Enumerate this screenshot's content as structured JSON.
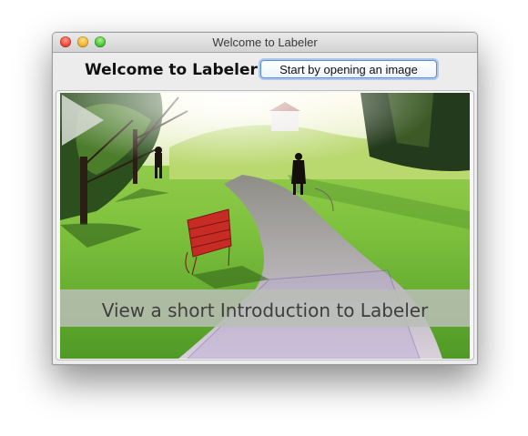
{
  "window": {
    "title": "Welcome to Labeler"
  },
  "header": {
    "welcome_label": "Welcome to Labeler",
    "open_button_label": "Start by opening an image"
  },
  "video": {
    "caption": "View a short Introduction to Labeler",
    "play_icon": "play-icon"
  },
  "colors": {
    "accent_focus": "#5d8fd6",
    "close": "#f04a3c",
    "minimize": "#f4b530",
    "zoom": "#4cc63c"
  }
}
